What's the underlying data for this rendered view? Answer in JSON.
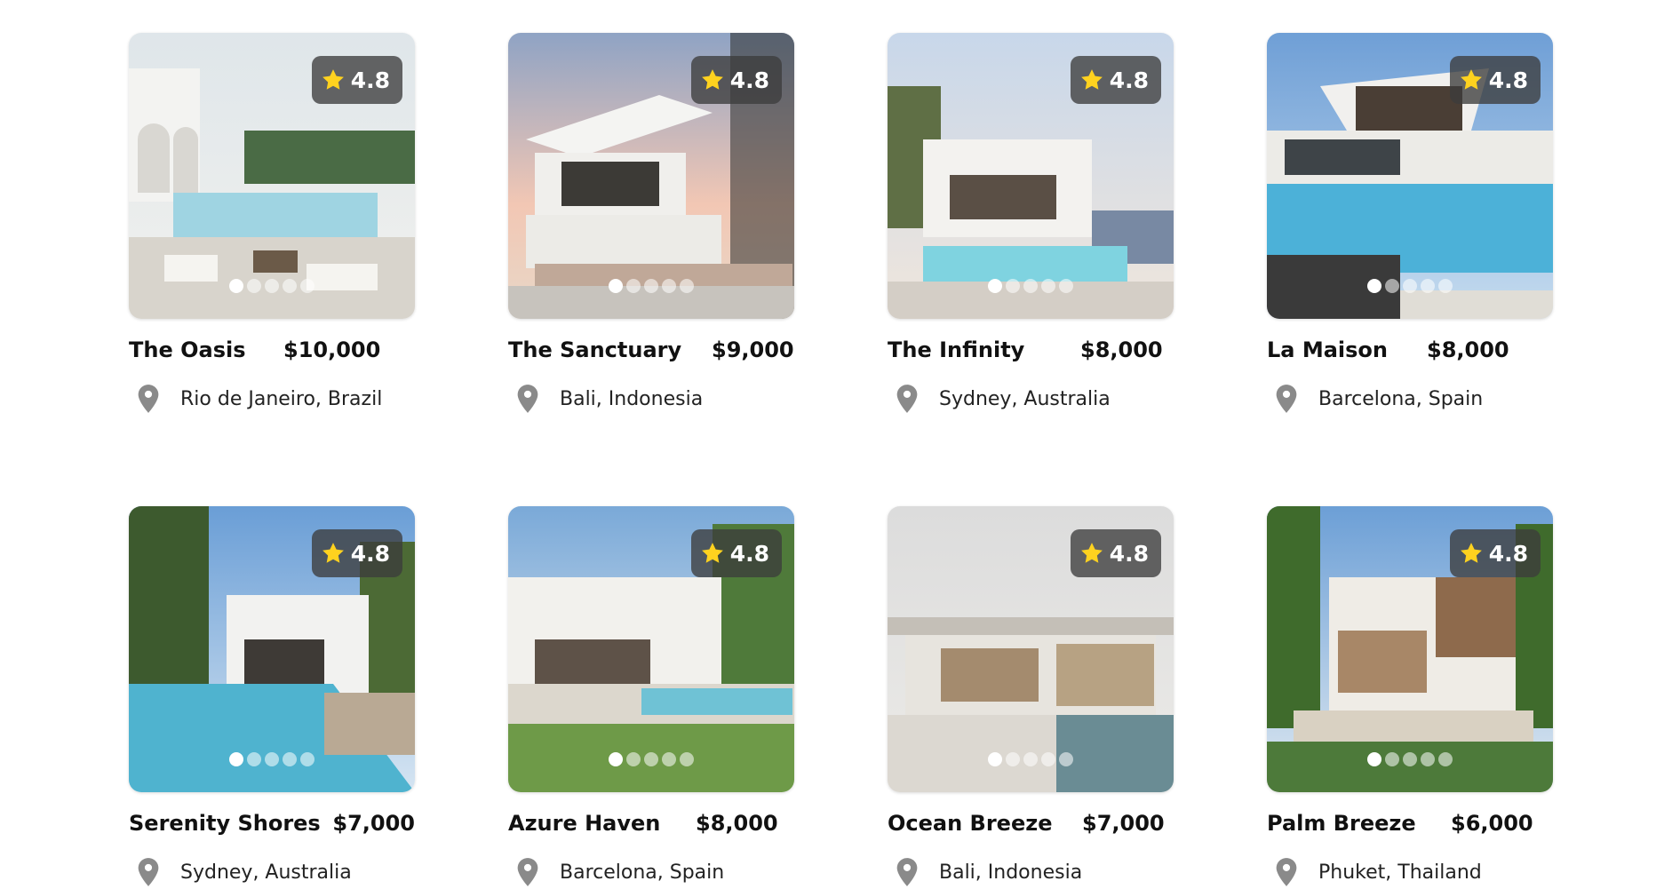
{
  "listings": [
    {
      "title": "The Oasis",
      "price": "$10,000",
      "location": "Rio de Janeiro, Brazil",
      "rating": "4.8",
      "active_dot": 0,
      "dots": 5
    },
    {
      "title": "The Sanctuary",
      "price": "$9,000",
      "location": "Bali, Indonesia",
      "rating": "4.8",
      "active_dot": 0,
      "dots": 5
    },
    {
      "title": "The Infinity",
      "price": "$8,000",
      "location": "Sydney, Australia",
      "rating": "4.8",
      "active_dot": 0,
      "dots": 5
    },
    {
      "title": "La Maison",
      "price": "$8,000",
      "location": "Barcelona, Spain",
      "rating": "4.8",
      "active_dot": 0,
      "dots": 5
    },
    {
      "title": "Serenity Shores",
      "price": "$7,000",
      "location": "Sydney, Australia",
      "rating": "4.8",
      "active_dot": 0,
      "dots": 5
    },
    {
      "title": "Azure Haven",
      "price": "$8,000",
      "location": "Barcelona, Spain",
      "rating": "4.8",
      "active_dot": 0,
      "dots": 5
    },
    {
      "title": "Ocean Breeze",
      "price": "$7,000",
      "location": "Bali, Indonesia",
      "rating": "4.8",
      "active_dot": 0,
      "dots": 5
    },
    {
      "title": "Palm Breeze",
      "price": "$6,000",
      "location": "Phuket, Thailand",
      "rating": "4.8",
      "active_dot": 0,
      "dots": 5
    }
  ],
  "colors": {
    "star": "#FFD21F",
    "pin": "#8a8a8a",
    "badge_bg": "#3c3c3c"
  }
}
